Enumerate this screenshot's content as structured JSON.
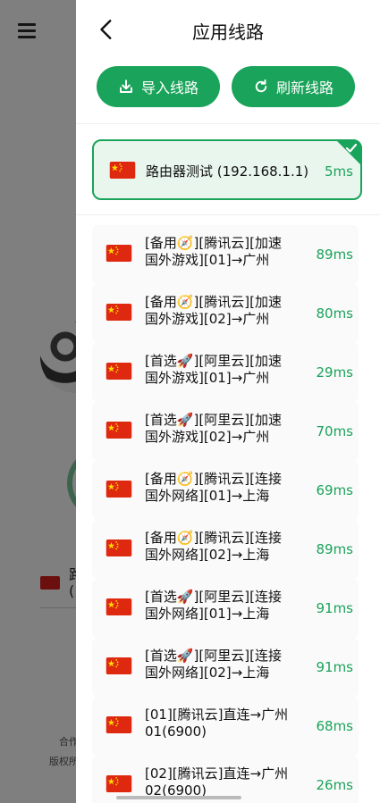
{
  "header": {
    "title": "应用线路"
  },
  "buttons": {
    "import_label": "导入线路",
    "refresh_label": "刷新线路"
  },
  "colors": {
    "accent": "#1aa35a",
    "flag_red": "#de2910",
    "flag_star": "#ffde00"
  },
  "selected": {
    "name": "路由器测试 (192.168.1.1)",
    "latency": "5ms"
  },
  "routes": [
    {
      "line1": "[备用🧭][腾讯云][加速",
      "line2": "国外游戏][01]→广州",
      "latency": "89ms"
    },
    {
      "line1": "[备用🧭][腾讯云][加速",
      "line2": "国外游戏][02]→广州",
      "latency": "80ms"
    },
    {
      "line1": "[首选🚀][阿里云][加速",
      "line2": "国外游戏][01]→广州",
      "latency": "29ms"
    },
    {
      "line1": "[首选🚀][阿里云][加速",
      "line2": "国外游戏][02]→广州",
      "latency": "70ms"
    },
    {
      "line1": "[备用🧭][腾讯云][连接",
      "line2": "国外网络][01]→上海",
      "latency": "69ms"
    },
    {
      "line1": "[备用🧭][腾讯云][连接",
      "line2": "国外网络][02]→上海",
      "latency": "89ms"
    },
    {
      "line1": "[首选🚀][阿里云][连接",
      "line2": "国外网络][01]→上海",
      "latency": "91ms"
    },
    {
      "line1": "[首选🚀][阿里云][连接",
      "line2": "国外网络][02]→上海",
      "latency": "91ms"
    },
    {
      "line1": "[01][腾讯云]直连→广州",
      "line2": "01(6900)",
      "latency": "68ms"
    },
    {
      "line1": "[02][腾讯云]直连→广州",
      "line2": "02(6900)",
      "latency": "26ms"
    }
  ],
  "background": {
    "row_text": "路\n(",
    "footer1": "合作",
    "footer2": "版权所"
  }
}
